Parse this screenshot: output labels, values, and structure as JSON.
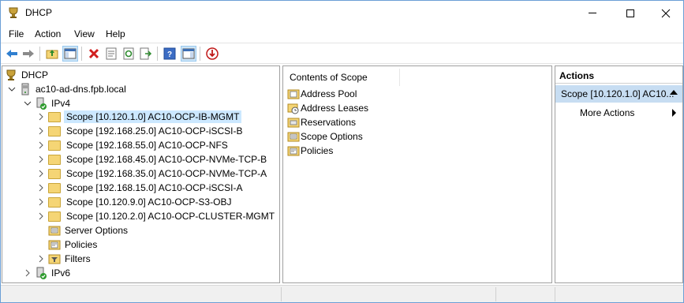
{
  "window": {
    "title": "DHCP",
    "controls": {
      "minimize": "minimize-icon",
      "maximize": "maximize-icon",
      "close": "close-icon"
    }
  },
  "menu": [
    "File",
    "Action",
    "View",
    "Help"
  ],
  "toolbar": [
    "back-icon",
    "forward-icon",
    "up-folder-icon",
    "show-hide-console-tree-icon",
    "delete-icon",
    "properties-icon",
    "refresh-icon",
    "export-list-icon",
    "help-icon",
    "show-action-pane-icon",
    "deactivate-icon"
  ],
  "tree": {
    "root": "DHCP",
    "server": "ac10-ad-dns.fpb.local",
    "ipv4": "IPv4",
    "scopes": [
      "Scope [10.120.1.0] AC10-OCP-IB-MGMT",
      "Scope [192.168.25.0] AC10-OCP-iSCSI-B",
      "Scope [192.168.55.0] AC10-OCP-NFS",
      "Scope [192.168.45.0] AC10-OCP-NVMe-TCP-B",
      "Scope [192.168.35.0] AC10-OCP-NVMe-TCP-A",
      "Scope [192.168.15.0] AC10-OCP-iSCSI-A",
      "Scope [10.120.9.0] AC10-OCP-S3-OBJ",
      "Scope [10.120.2.0] AC10-OCP-CLUSTER-MGMT"
    ],
    "server_options": "Server Options",
    "policies": "Policies",
    "filters": "Filters",
    "ipv6": "IPv6",
    "selected_index": 0
  },
  "contents": {
    "header": "Contents of Scope",
    "items": [
      "Address Pool",
      "Address Leases",
      "Reservations",
      "Scope Options",
      "Policies"
    ]
  },
  "actions": {
    "title": "Actions",
    "scope": "Scope [10.120.1.0] AC10...",
    "more": "More Actions"
  },
  "colors": {
    "selection": "#cce8ff",
    "actions_highlight": "#c7ddf2",
    "folder": "#f5d575",
    "accent": "#0063b1"
  }
}
